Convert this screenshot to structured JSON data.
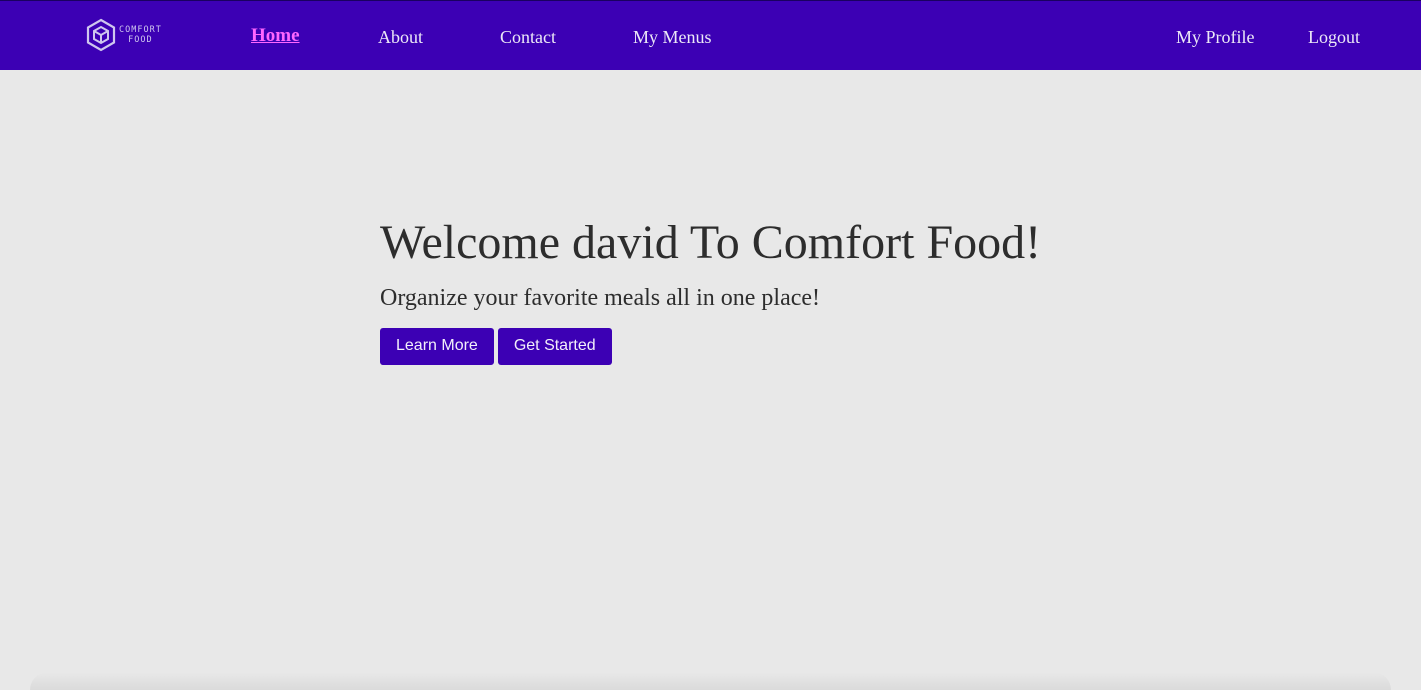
{
  "brand": {
    "logo_line1": "COMFORT",
    "logo_line2": "FOOD",
    "logo_icon": "hexagon-cube-icon"
  },
  "nav": {
    "home": "Home",
    "about": "About",
    "contact": "Contact",
    "my_menus": "My Menus",
    "my_profile": "My Profile",
    "logout": "Logout",
    "active": "home"
  },
  "hero": {
    "title": "Welcome david To Comfort Food!",
    "subtitle": "Organize your favorite meals all in one place!",
    "learn_more": "Learn More",
    "get_started": "Get Started"
  },
  "colors": {
    "primary": "#3c00b4",
    "active_link": "#ff66ff",
    "background": "#e8e8e8",
    "text": "#2d2d2d"
  }
}
